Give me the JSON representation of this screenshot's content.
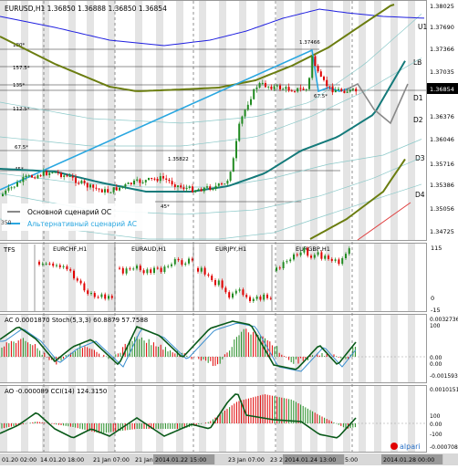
{
  "main": {
    "header": "EURUSD,H1  1.36850 1.36888 1.36850 1.36854",
    "price_labels": [
      "1.38025",
      "1.37690",
      "1.37366",
      "1.37035",
      "1.36854",
      "1.36376",
      "1.36046",
      "1.35716",
      "1.35386",
      "1.35056",
      "1.34725"
    ],
    "level_labels": [
      "U1",
      "LB",
      "D1",
      "D2",
      "D3",
      "D4"
    ],
    "fib_labels": [
      "180*",
      "157.5*",
      "135*",
      "112.5*",
      "67.5*",
      "45*",
      "45*",
      "67.5*"
    ],
    "annotations": [
      "1.37466",
      "1.35822"
    ],
    "legend": {
      "primary": "Основной сценарий ОС",
      "alternate": "Альтернативный сценарий АС"
    },
    "left_edge": "350"
  },
  "tfs": {
    "label": "TFS",
    "panels": [
      "EURCHF,H1",
      "EURAUD,H1",
      "EURJPY,H1",
      "EURGBP,H1"
    ],
    "scale": [
      "115",
      "0",
      "-15"
    ]
  },
  "ac_stoch": {
    "header": "AC  0.0001870  Stoch(5,3,3)  60.8879  57.7588",
    "scale": [
      "0.0032736",
      "100",
      "0.00",
      "0.00",
      "-0.001593"
    ]
  },
  "ao_cci": {
    "header": "AO  -0.000089  CCI(14)  124.3150",
    "scale": [
      "0.0010151",
      "100",
      "0.00",
      "-100",
      "-0.000708"
    ],
    "logo": "alpari"
  },
  "time_axis": [
    "01.20 02:00",
    "14.01.20 18:00",
    "21 Jan 07:00",
    "21 Jan 23:00",
    "2014.01.22 15:00",
    "23 Jan 07:00",
    "23 2",
    "2014.01.24 13:00",
    "5:00",
    "2014.01.28 00:00"
  ],
  "colors": {
    "bull": "#228b22",
    "bear": "#e00000",
    "trendline": "#2aa7e0",
    "ma_olive": "#6b7d10",
    "ma_teal": "#147a7a",
    "ma_blue": "#2020e0"
  }
}
